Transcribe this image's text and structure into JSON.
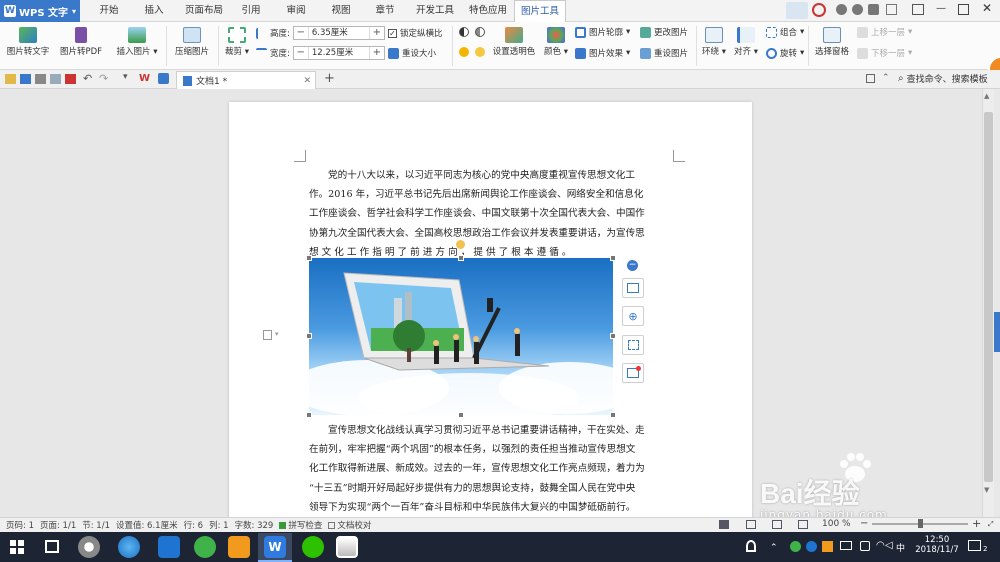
{
  "app": {
    "name": "WPS 文字"
  },
  "menu": {
    "tabs": [
      "开始",
      "插入",
      "页面布局",
      "引用",
      "审阅",
      "视图",
      "章节",
      "开发工具",
      "特色应用",
      "图片工具"
    ],
    "active": "图片工具"
  },
  "ribbon": {
    "pic_to_text": "图片转文字",
    "pic_to_pdf": "图片转PDF",
    "insert_pic": "插入图片",
    "compress": "压缩图片",
    "crop": "裁剪",
    "height_label": "高度:",
    "height_value": "6.35厘米",
    "width_label": "宽度:",
    "width_value": "12.25厘米",
    "lock_ratio": "锁定纵横比",
    "reset_size": "重设大小",
    "transparent": "设置透明色",
    "color": "颜色",
    "outline": "图片轮廓",
    "effects": "图片效果",
    "change_pic": "更改图片",
    "reset_pic": "重设图片",
    "wrap": "环绕",
    "align": "对齐",
    "rotate": "旋转",
    "group": "组合",
    "selection_pane": "选择窗格",
    "bring_forward": "上移一层",
    "send_backward": "下移一层",
    "search": "查找命令、搜索模板"
  },
  "doc_tab": {
    "title": "文档1 *"
  },
  "document": {
    "para1": [
      "党的十八大以来，以习近平同志为核心的党中央高度重视宣传思想文化工",
      "作。2016 年，习近平总书记先后出席新闻舆论工作座谈会、网络安全和信息化",
      "工作座谈会、哲学社会科学工作座谈会、中国文联第十次全国代表大会、中国作",
      "协第九次全国代表大会、全国高校思想政治工作会议并发表重要讲话，为宣传思",
      "想 文 化 工 作 指 明 了 前 进 方 向 ， 提 供 了 根 本 遵 循 。"
    ],
    "para2": [
      "宣传思想文化战线认真学习贯彻习近平总书记重要讲话精神，干在实处、走",
      "在前列，牢牢把握“两个巩固”的根本任务，以强烈的责任担当推动宣传思想文",
      "化工作取得新进展、新成效。过去的一年，宣传思想文化工作亮点频现，着力为",
      "“十三五”时期开好局起好步提供有力的思想舆论支持，鼓舞全国人民在党中央",
      "领导下为实现“两个一百年”奋斗目标和中华民族伟大复兴的中国梦砥砺前行。"
    ]
  },
  "status": {
    "page_no": "页码: 1",
    "pages": "页面: 1/1",
    "section": "节: 1/1",
    "setting": "设置值: 6.1厘米",
    "row": "行: 6",
    "col": "列: 1",
    "words": "字数: 329",
    "spell": "拼写检查",
    "proof": "文档校对",
    "zoom": "100 %"
  },
  "taskbar": {
    "time": "12:50",
    "date": "2018/11/7",
    "ime": "中",
    "notif_count": "2"
  },
  "watermark": {
    "text": "Bai经验",
    "url": "jingyan.baidu.com"
  }
}
